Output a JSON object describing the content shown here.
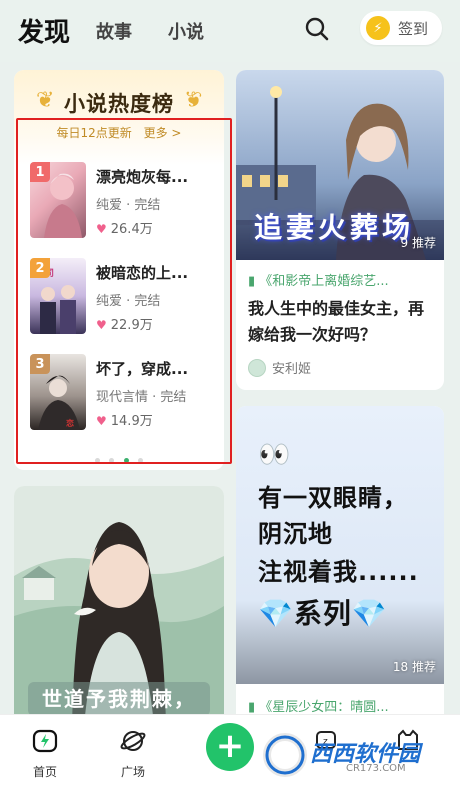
{
  "header": {
    "tabs": [
      {
        "label": "发现",
        "active": true
      },
      {
        "label": "故事",
        "active": false
      },
      {
        "label": "小说",
        "active": false
      }
    ],
    "search_icon": "search-icon",
    "signin_label": "签到",
    "signin_icon": "lightning-coin-icon"
  },
  "ranking": {
    "title": "小说热度榜",
    "subtitle": "每日12点更新",
    "more": "更多 >",
    "items": [
      {
        "rank": "1",
        "title": "漂亮炮灰每...",
        "meta": "纯爱 · 完结",
        "heat": "26.4万",
        "badge_color": "#f06a6a"
      },
      {
        "rank": "2",
        "title": "被暗恋的上...",
        "meta": "纯爱 · 完结",
        "heat": "22.9万",
        "badge_color": "#f3a23a"
      },
      {
        "rank": "3",
        "title": "坏了，穿成...",
        "meta": "现代言情 · 完结",
        "heat": "14.9万",
        "badge_color": "#c9935a"
      }
    ],
    "page_count": 4,
    "active_page": 3
  },
  "card_right_top": {
    "cover_text": "追妻火葬场",
    "recommend": "9 推荐",
    "tag": "《和影帝上离婚综艺...",
    "title": "我人生中的最佳女主，再嫁给我一次好吗？",
    "author": "安利姬"
  },
  "card_right_bottom": {
    "lines": [
      "👀",
      "有一双眼睛，",
      "阴沉地",
      "注视着我......",
      "💎系列💎"
    ],
    "recommend": "18 推荐",
    "tag": "《星辰少女四：晴圆..."
  },
  "card_left_bottom": {
    "banner": "世道予我荆棘，"
  },
  "bottom_nav": {
    "items": [
      {
        "label": "首页",
        "icon": "lightning-home-icon",
        "active": true
      },
      {
        "label": "广场",
        "icon": "planet-icon",
        "active": false
      }
    ],
    "plus": "+"
  },
  "watermark": {
    "text": "西西软件园",
    "sub": "CR173.COM"
  },
  "colors": {
    "accent": "#22c36a",
    "highlight_box": "#e02020",
    "tag_green": "#4aa66e",
    "heat_pink": "#f0608c"
  }
}
